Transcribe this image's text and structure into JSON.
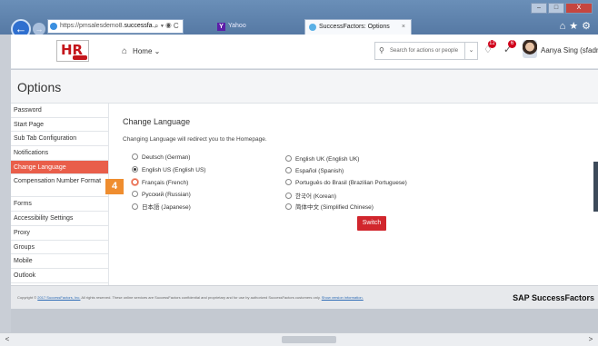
{
  "browser": {
    "url_prefix": "https://pmsalesdemo8.",
    "url_domain": "successfa...",
    "addr_icons": "⌕ ▾ ◉ C",
    "tabs": [
      {
        "label": "Yahoo",
        "icon": "yahoo-icon"
      },
      {
        "label": "SuccessFactors: Options",
        "close": "×",
        "icon": "successfactors-icon"
      }
    ],
    "window_controls": [
      "–",
      "□",
      "X"
    ],
    "toolbar_icons": "⌂★⚙"
  },
  "header": {
    "logo_text": "HR",
    "home_label": "Home ⌄",
    "search_placeholder": "Search for actions or people",
    "notifications_badge": "12",
    "approvals_badge": "6",
    "user_name": "Aanya Sing (sfadmin) ⌄"
  },
  "page": {
    "title": "Options"
  },
  "sidebar": {
    "items": [
      {
        "label": "Password"
      },
      {
        "label": "Start Page"
      },
      {
        "label": "Sub Tab Configuration"
      },
      {
        "label": "Notifications"
      },
      {
        "label": "Change Language",
        "active": true
      },
      {
        "label": "Compensation Number Format"
      },
      {
        "label": "Forms"
      },
      {
        "label": "Accessibility Settings"
      },
      {
        "label": "Proxy"
      },
      {
        "label": "Groups"
      },
      {
        "label": "Mobile"
      },
      {
        "label": "Outlook"
      }
    ]
  },
  "content": {
    "heading": "Change Language",
    "redirect_note": "Changing Language will redirect you to the Homepage.",
    "languages_left": [
      {
        "label": "Deutsch (German)",
        "selected": false
      },
      {
        "label": "English US (English US)",
        "selected": true
      },
      {
        "label": "Français (French)",
        "selected": false
      },
      {
        "label": "Русский (Russian)",
        "selected": false
      },
      {
        "label": "日本語 (Japanese)",
        "selected": false
      }
    ],
    "languages_right": [
      {
        "label": "English UK (English UK)",
        "selected": false
      },
      {
        "label": "Español (Spanish)",
        "selected": false
      },
      {
        "label": "Português do Brasil (Brazilian Portuguese)",
        "selected": false
      },
      {
        "label": "한국어 (Korean)",
        "selected": false
      },
      {
        "label": "简体中文 (Simplified Chinese)",
        "selected": false
      }
    ],
    "switch_label": "Switch",
    "step_number": "4"
  },
  "footer": {
    "copyright_prefix": "Copyright © ",
    "copyright_link": "2017 SuccessFactors, Inc.",
    "copyright_text": " All rights reserved. These online services are SuccessFactors confidential and proprietary and for use by authorized SuccessFactors customers only. ",
    "privacy_link": "Show version information.",
    "brand": "SAP SuccessFactors"
  },
  "scrollbar": {
    "left_arrow": "<",
    "right_arrow": ">"
  },
  "colors": {
    "accent_active": "#e95e4a",
    "switch_button": "#d1262d",
    "step_callout": "#ef8d2f"
  }
}
